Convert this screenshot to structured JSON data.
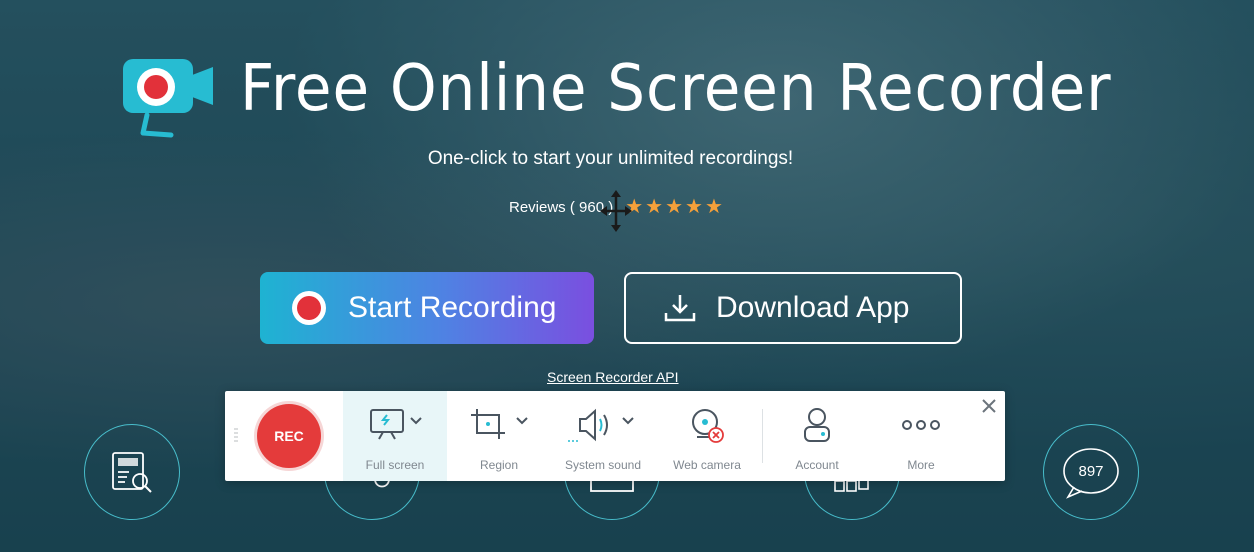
{
  "header": {
    "title": "Free Online Screen Recorder",
    "subtitle": "One-click to start your unlimited recordings!",
    "reviews_label": "Reviews ( 960 )",
    "rating_stars": 5,
    "star_color": "#f6a03a"
  },
  "actions": {
    "start_label": "Start Recording",
    "download_label": "Download App",
    "api_link": "Screen Recorder API"
  },
  "toolbar": {
    "rec_label": "REC",
    "tools": [
      {
        "label": "Full screen",
        "icon": "monitor-icon",
        "active": true
      },
      {
        "label": "Region",
        "icon": "crop-icon"
      },
      {
        "label": "System sound",
        "icon": "speaker-icon"
      },
      {
        "label": "Web camera",
        "icon": "webcam-icon"
      },
      {
        "label": "Account",
        "icon": "account-icon"
      },
      {
        "label": "More",
        "icon": "more-icon"
      }
    ]
  },
  "feature_circles": {
    "comment_count": "897"
  },
  "colors": {
    "accent": "#1eb3d2",
    "rec_red": "#e43b3b",
    "gradient_end": "#7a4fe0"
  }
}
